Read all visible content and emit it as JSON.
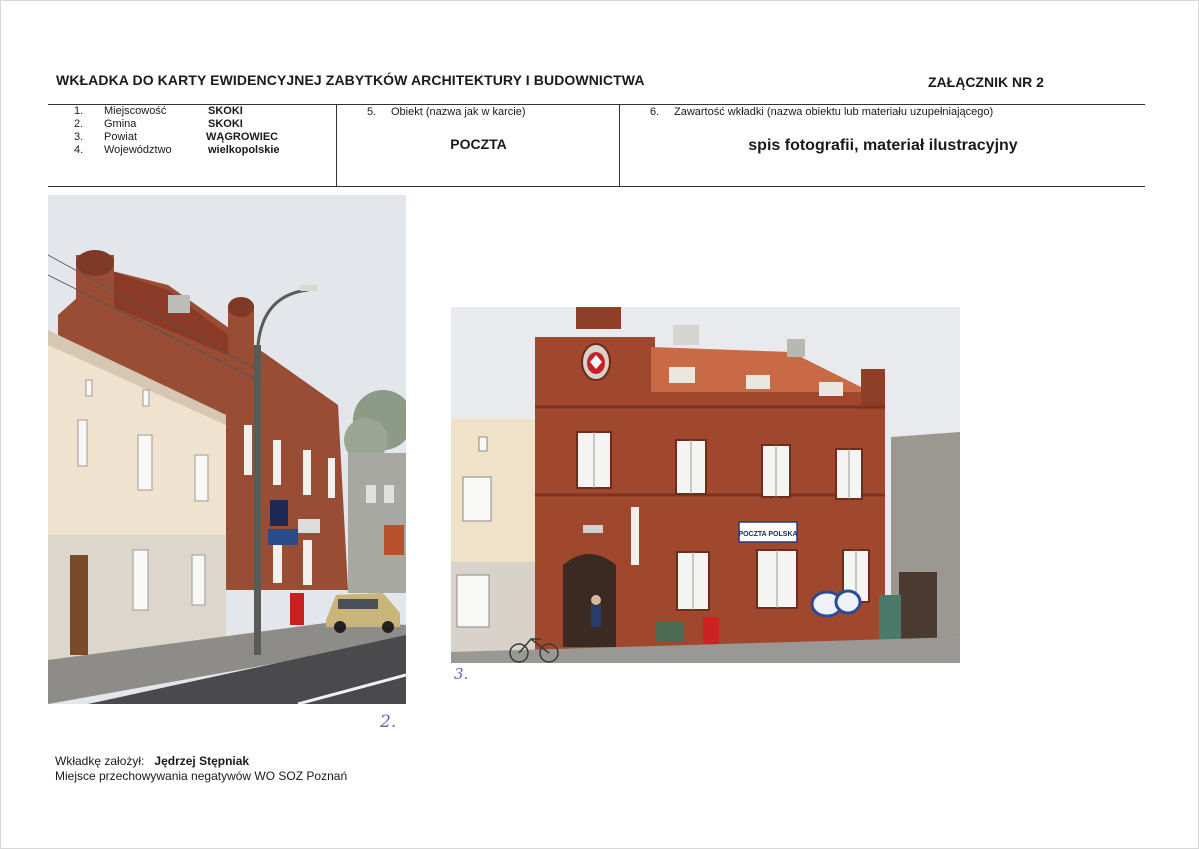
{
  "header": {
    "title": "WKŁADKA DO KARTY EWIDENCYJNEJ ZABYTKÓW ARCHITEKTURY I BUDOWNICTWA",
    "attachment": "ZAŁĄCZNIK NR 2"
  },
  "location": [
    {
      "num": "1.",
      "label": "Miejscowość",
      "value": "SKOKI"
    },
    {
      "num": "2.",
      "label": "Gmina",
      "value": "SKOKI"
    },
    {
      "num": "3.",
      "label": "Powiat",
      "value": "WĄGROWIEC"
    },
    {
      "num": "4.",
      "label": "Województwo",
      "value": "wielkopolskie"
    }
  ],
  "object": {
    "num": "5.",
    "label": "Obiekt (nazwa jak w karcie)",
    "value": "POCZTA"
  },
  "contents": {
    "num": "6.",
    "label": "Zawartość wkładki (nazwa obiektu lub materiału uzupełniającego)",
    "value": "spis fotografii, materiał ilustracyjny"
  },
  "photos": {
    "photo_1_number": "2.",
    "photo_2_number": "3.",
    "sign_text": "POCZTA POLSKA"
  },
  "footer": {
    "author_label": "Wkładkę założył:",
    "author_name": "Jędrzej Stępniak",
    "negatives_storage": "Miejsce przechowywania negatywów WO SOZ Poznań"
  }
}
